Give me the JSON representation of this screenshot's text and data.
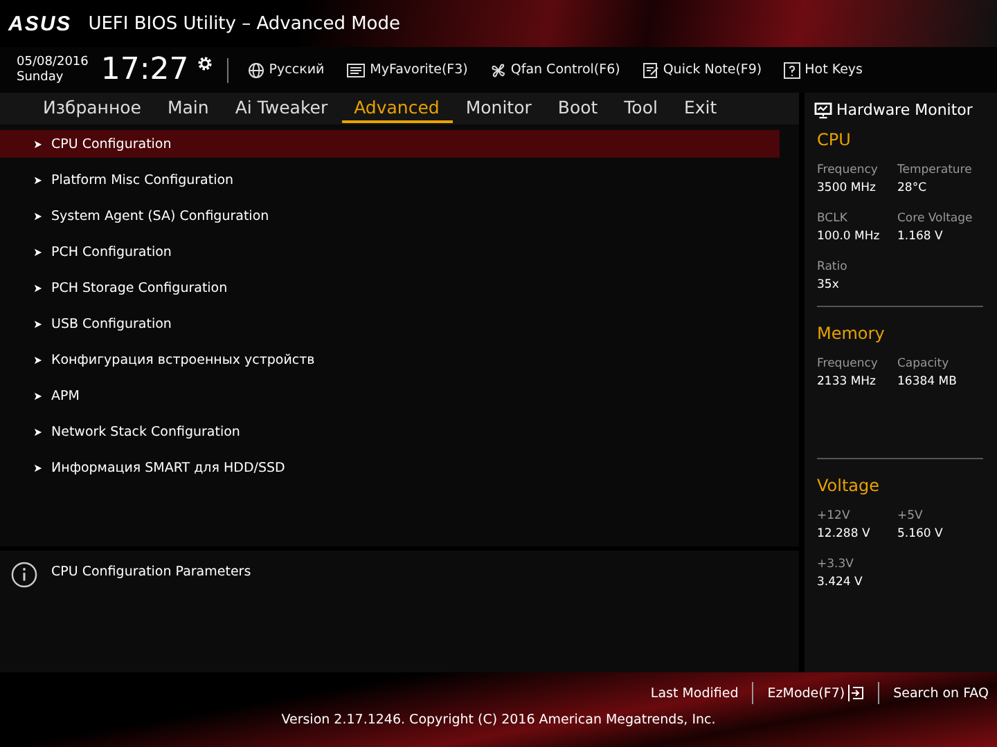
{
  "header": {
    "logo": "ASUS",
    "title": "UEFI BIOS Utility – Advanced Mode"
  },
  "toolbar": {
    "date": "05/08/2016",
    "day": "Sunday",
    "time": "17:27",
    "items": [
      {
        "kind": "globe",
        "label": "Русский"
      },
      {
        "kind": "favorite",
        "label": "MyFavorite(F3)"
      },
      {
        "kind": "fan",
        "label": "Qfan Control(F6)"
      },
      {
        "kind": "note",
        "label": "Quick Note(F9)"
      },
      {
        "kind": "help",
        "label": "Hot Keys"
      }
    ]
  },
  "tabs": [
    {
      "label": "Избранное",
      "selected": false
    },
    {
      "label": "Main",
      "selected": false
    },
    {
      "label": "Ai Tweaker",
      "selected": false
    },
    {
      "label": "Advanced",
      "selected": true
    },
    {
      "label": "Monitor",
      "selected": false
    },
    {
      "label": "Boot",
      "selected": false
    },
    {
      "label": "Tool",
      "selected": false
    },
    {
      "label": "Exit",
      "selected": false
    }
  ],
  "menu": [
    {
      "label": "CPU Configuration",
      "selected": true
    },
    {
      "label": "Platform Misc Configuration",
      "selected": false
    },
    {
      "label": "System Agent (SA) Configuration",
      "selected": false
    },
    {
      "label": "PCH Configuration",
      "selected": false
    },
    {
      "label": "PCH Storage Configuration",
      "selected": false
    },
    {
      "label": "USB Configuration",
      "selected": false
    },
    {
      "label": "Конфигурация встроенных устройств",
      "selected": false
    },
    {
      "label": "APM",
      "selected": false
    },
    {
      "label": "Network Stack Configuration",
      "selected": false
    },
    {
      "label": "Информация SMART для HDD/SSD",
      "selected": false
    }
  ],
  "help_text": "CPU Configuration Parameters",
  "hardware_monitor": {
    "title": "Hardware Monitor",
    "sections": [
      {
        "title": "CPU",
        "readings": [
          {
            "label": "Frequency",
            "value": "3500 MHz"
          },
          {
            "label": "Temperature",
            "value": "28°C"
          },
          {
            "label": "BCLK",
            "value": "100.0 MHz"
          },
          {
            "label": "Core Voltage",
            "value": "1.168 V"
          },
          {
            "label": "Ratio",
            "value": "35x"
          }
        ]
      },
      {
        "title": "Memory",
        "readings": [
          {
            "label": "Frequency",
            "value": "2133 MHz"
          },
          {
            "label": "Capacity",
            "value": "16384 MB"
          }
        ]
      },
      {
        "title": "Voltage",
        "readings": [
          {
            "label": "+12V",
            "value": "12.288 V"
          },
          {
            "label": "+5V",
            "value": "5.160 V"
          },
          {
            "label": "+3.3V",
            "value": "3.424 V"
          }
        ]
      }
    ]
  },
  "footer": {
    "links": [
      "Last Modified",
      "EzMode(F7)",
      "Search on FAQ"
    ],
    "version": "Version 2.17.1246. Copyright (C) 2016 American Megatrends, Inc."
  }
}
